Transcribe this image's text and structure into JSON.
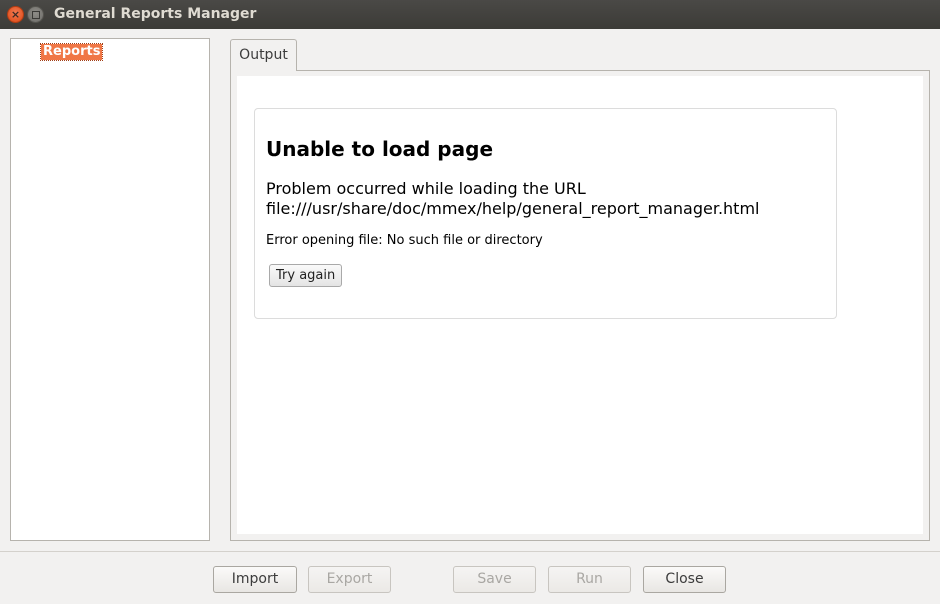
{
  "window": {
    "title": "General Reports Manager"
  },
  "tree": {
    "items": [
      {
        "label": "Reports",
        "selected": true
      }
    ]
  },
  "tabs": [
    {
      "label": "Output",
      "active": true
    }
  ],
  "error_page": {
    "heading": "Unable to load page",
    "message_line1": "Problem occurred while loading the URL",
    "message_line2": "file:///usr/share/doc/mmex/help/general_report_manager.html",
    "detail": "Error opening file: No such file or directory",
    "retry_label": "Try again"
  },
  "buttons": {
    "import": {
      "label": "Import",
      "enabled": true
    },
    "export": {
      "label": "Export",
      "enabled": false
    },
    "save": {
      "label": "Save",
      "enabled": false
    },
    "run": {
      "label": "Run",
      "enabled": false
    },
    "close": {
      "label": "Close",
      "enabled": true
    }
  },
  "colors": {
    "selection": "#f07746",
    "titlebar": "#3c3b37",
    "close_button": "#dd4814"
  }
}
